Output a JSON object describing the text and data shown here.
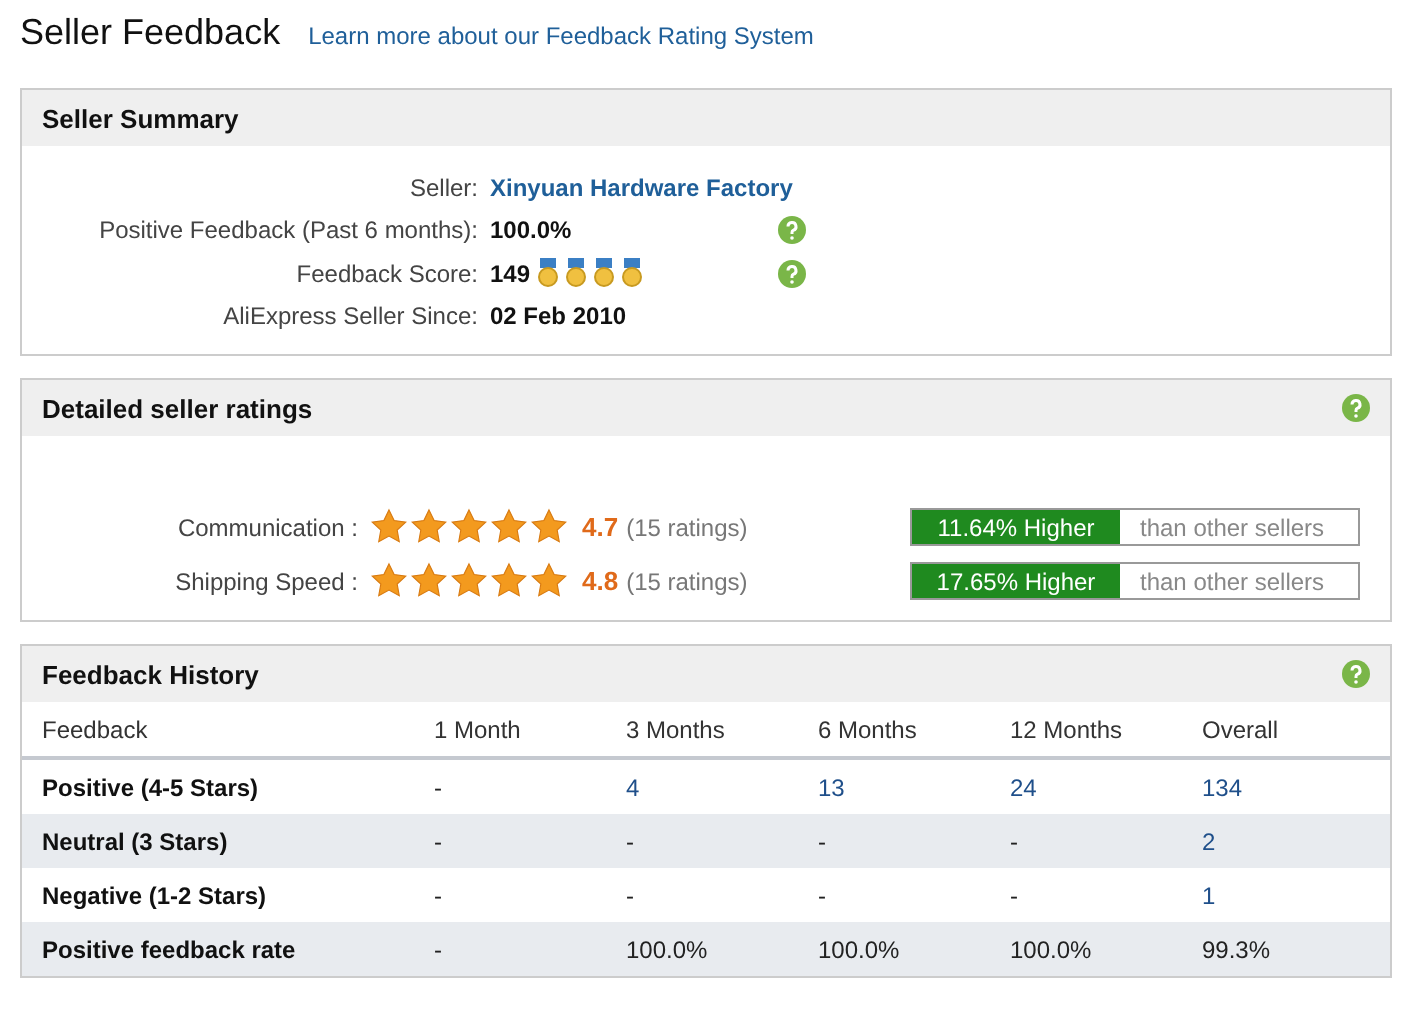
{
  "page": {
    "title": "Seller Feedback",
    "link": "Learn more about our Feedback Rating System"
  },
  "summary": {
    "title": "Seller Summary",
    "rows": [
      {
        "label": "Seller:",
        "value": "Xinyuan Hardware Factory",
        "kind": "link",
        "help": false
      },
      {
        "label": "Positive Feedback (Past 6 months):",
        "value": "100.0%",
        "kind": "text",
        "help": true
      },
      {
        "label": "Feedback Score:",
        "value": "149",
        "kind": "medals",
        "help": true
      },
      {
        "label": "AliExpress Seller Since:",
        "value": "02 Feb 2010",
        "kind": "text",
        "help": false
      }
    ]
  },
  "ratings": {
    "title": "Detailed seller ratings",
    "rows": [
      {
        "label": "Communication :",
        "stars": 5,
        "score": "4.7",
        "count": "(15 ratings)",
        "comparison": "11.64% Higher",
        "suffix": "than other sellers"
      },
      {
        "label": "Shipping Speed :",
        "stars": 5,
        "score": "4.8",
        "count": "(15 ratings)",
        "comparison": "17.65% Higher",
        "suffix": "than other sellers"
      }
    ]
  },
  "history": {
    "title": "Feedback History",
    "columns": [
      "Feedback",
      "1 Month",
      "3 Months",
      "6 Months",
      "12 Months",
      "Overall"
    ],
    "rows": [
      {
        "cells": [
          {
            "text": "Positive (4-5 Stars)"
          },
          {
            "text": "-",
            "link": false
          },
          {
            "text": "4",
            "link": true
          },
          {
            "text": "13",
            "link": true
          },
          {
            "text": "24",
            "link": true
          },
          {
            "text": "134",
            "link": true
          }
        ]
      },
      {
        "cells": [
          {
            "text": "Neutral (3 Stars)"
          },
          {
            "text": "-",
            "link": false
          },
          {
            "text": "-",
            "link": false
          },
          {
            "text": "-",
            "link": false
          },
          {
            "text": "-",
            "link": false
          },
          {
            "text": "2",
            "link": true
          }
        ]
      },
      {
        "cells": [
          {
            "text": "Negative (1-2 Stars)"
          },
          {
            "text": "-",
            "link": false
          },
          {
            "text": "-",
            "link": false
          },
          {
            "text": "-",
            "link": false
          },
          {
            "text": "-",
            "link": false
          },
          {
            "text": "1",
            "link": true
          }
        ]
      },
      {
        "cells": [
          {
            "text": "Positive feedback rate"
          },
          {
            "text": "-",
            "link": false
          },
          {
            "text": "100.0%",
            "link": false
          },
          {
            "text": "100.0%",
            "link": false
          },
          {
            "text": "100.0%",
            "link": false
          },
          {
            "text": "99.3%",
            "link": false
          }
        ]
      }
    ]
  }
}
